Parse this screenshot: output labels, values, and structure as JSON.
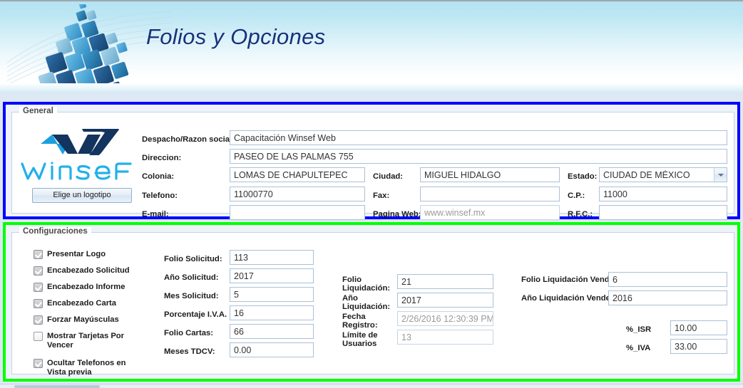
{
  "header": {
    "title": "Folios y Opciones",
    "logo_icon": "blue-cubes-icon"
  },
  "general": {
    "legend": "General",
    "logo": {
      "brand_text": "WinseF",
      "button_label": "Elige un logotipo"
    },
    "fields": [
      {
        "name": "despacho",
        "label": "Despacho/Razon social:",
        "value": "Capacitación Winsef Web"
      },
      {
        "name": "direccion",
        "label": "Direccion:",
        "value": "PASEO DE LAS PALMAS 755"
      },
      {
        "name": "colonia",
        "label": "Colonia:",
        "value": "LOMAS DE CHAPULTEPEC"
      },
      {
        "name": "ciudad",
        "label": "Ciudad:",
        "value": "MIGUEL HIDALGO"
      },
      {
        "name": "estado",
        "label": "Estado:",
        "value": "CIUDAD DE MÉXICO",
        "type": "combo"
      },
      {
        "name": "telefono",
        "label": "Telefono:",
        "value": "11000770"
      },
      {
        "name": "fax",
        "label": "Fax:",
        "value": ""
      },
      {
        "name": "cp",
        "label": "C.P.:",
        "value": "11000"
      },
      {
        "name": "email",
        "label": "E-mail:",
        "value": ""
      },
      {
        "name": "pagina_web",
        "label": "Pagina Web:",
        "value": "www.winsef.mx"
      },
      {
        "name": "rfc",
        "label": "R.F.C.:",
        "value": ""
      }
    ]
  },
  "configuraciones": {
    "legend": "Configuraciones",
    "checkboxes": [
      {
        "label": "Presentar Logo",
        "checked": true
      },
      {
        "label": "Encabezado Solicitud",
        "checked": true
      },
      {
        "label": "Encabezado Informe",
        "checked": true
      },
      {
        "label": "Encabezado Carta",
        "checked": true
      },
      {
        "label": "Forzar Mayúsculas",
        "checked": true
      },
      {
        "label": "Mostrar Tarjetas Por Vencer",
        "checked": false
      },
      {
        "label": "Ocultar Telefonos en Vista previa",
        "checked": true
      }
    ],
    "col_solicitud": [
      {
        "name": "folio-solicitud",
        "label": "Folio Solicitud:",
        "value": "113"
      },
      {
        "name": "ano-solicitud",
        "label": "Año Solicitud:",
        "value": "2017"
      },
      {
        "name": "mes-solicitud",
        "label": "Mes Solicitud:",
        "value": "5"
      },
      {
        "name": "porcentaje-iva",
        "label": "Porcentaje I.V.A.",
        "value": "16"
      },
      {
        "name": "folio-cartas",
        "label": "Folio Cartas:",
        "value": "66"
      },
      {
        "name": "meses-tdcv",
        "label": "Meses TDCV:",
        "value": "0.00"
      }
    ],
    "col_liquidacion": [
      {
        "name": "folio-liquidacion",
        "label": "Folio Liquidación:",
        "value": "21",
        "readonly": false
      },
      {
        "name": "ano-liquidacion",
        "label": "Año Liquidación:",
        "value": "2017",
        "readonly": false
      },
      {
        "name": "fecha-registro",
        "label": "Fecha Registro:",
        "value": "2/26/2016 12:30:39 PM",
        "readonly": true
      },
      {
        "name": "limite-usuarios",
        "label": "Límite de Usuarios",
        "value": "13",
        "readonly": true
      }
    ],
    "col_vendedor": [
      {
        "name": "folio-liquidacion-vendedor",
        "label": "Folio Liquidación Vendedor",
        "value": "6"
      },
      {
        "name": "ano-liquidacion-vendedor",
        "label": "Año Liquidación Vendedor",
        "value": "2016"
      }
    ],
    "col_percent": [
      {
        "name": "isr",
        "label": "%_ISR",
        "value": "10.00"
      },
      {
        "name": "iva",
        "label": "%_IVA",
        "value": "33.00"
      }
    ]
  },
  "colors": {
    "highlight_general": "#0000ff",
    "highlight_config": "#00ff00",
    "title": "#16327a",
    "banner_top": "#b3e3f2"
  }
}
